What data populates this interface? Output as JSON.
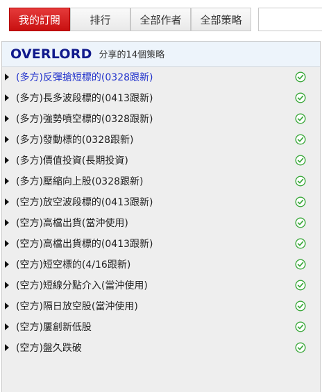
{
  "tabs": [
    {
      "label": "我的訂閱",
      "active": true
    },
    {
      "label": "排行",
      "active": false
    },
    {
      "label": "全部作者",
      "active": false
    },
    {
      "label": "全部策略",
      "active": false
    }
  ],
  "search": {
    "value": ""
  },
  "panel": {
    "author": "OVERLORD",
    "share_count": "分享的14個策略"
  },
  "strategies": [
    {
      "label": "(多方)反彈搶短標的(0328跟新)",
      "highlight": true
    },
    {
      "label": "(多方)長多波段標的(0413跟新)"
    },
    {
      "label": "(多方)強勢噴空標的(0328跟新)"
    },
    {
      "label": "(多方)發動標的(0328跟新)"
    },
    {
      "label": "(多方)價值投資(長期投資)"
    },
    {
      "label": "(多方)壓縮向上股(0328跟新)"
    },
    {
      "label": "(空方)放空波段標的(0413跟新)"
    },
    {
      "label": "(空方)高檔出貨(當沖使用)"
    },
    {
      "label": "(空方)高檔出貨標的(0413跟新)"
    },
    {
      "label": "(空方)短空標的(4/16跟新)"
    },
    {
      "label": "(空方)短線分點介入(當沖使用)"
    },
    {
      "label": "(空方)隔日放空股(當沖使用)"
    },
    {
      "label": "(空方)屢創新低股"
    },
    {
      "label": "(空方)盤久跌破"
    }
  ],
  "colors": {
    "active_tab": "#d42020",
    "author": "#111a8c",
    "highlight_text": "#2233cc",
    "check": "#3aa83a"
  },
  "icons": {
    "row_expand": "triangle-right-icon",
    "status": "check-circle-icon"
  }
}
